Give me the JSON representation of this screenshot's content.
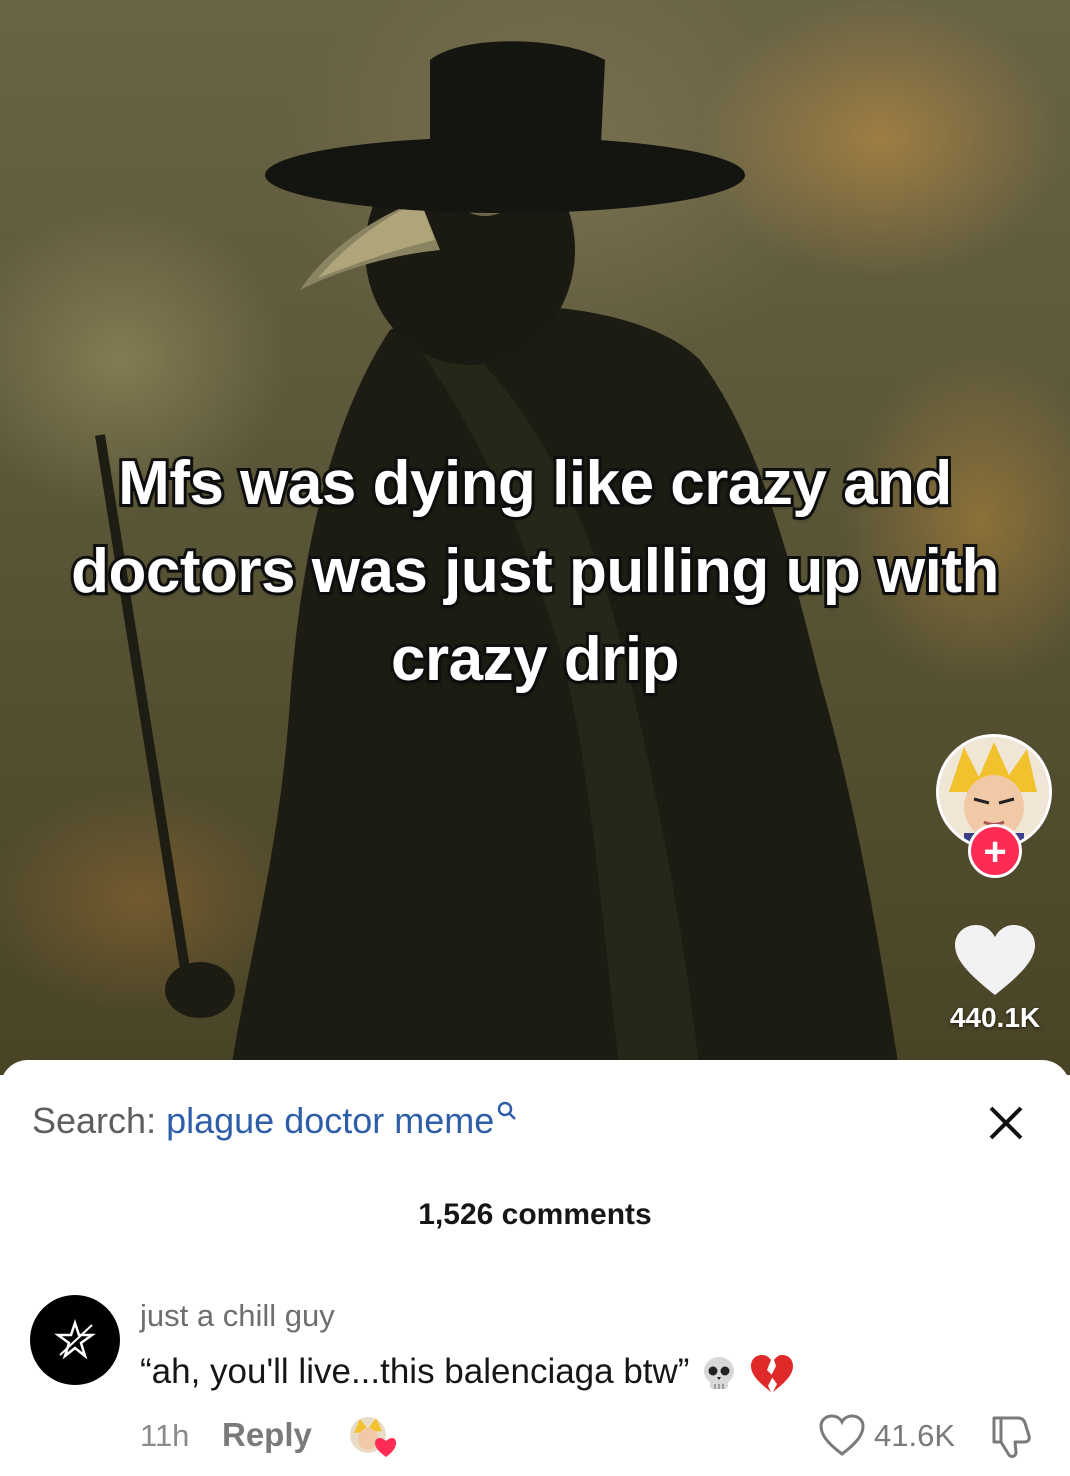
{
  "video": {
    "caption": "Mfs was dying like crazy and doctors was just pulling up with crazy drip",
    "like_count": "440.1K",
    "follow_symbol": "+"
  },
  "comments_panel": {
    "search_prefix": "Search:",
    "search_term": "plague doctor meme",
    "comment_count": "1,526 comments",
    "comments": [
      {
        "username": "just a chill guy",
        "text": "“ah, you'll live...this balenciaga btw”",
        "time": "11h",
        "reply_label": "Reply",
        "like_count": "41.6K"
      }
    ]
  },
  "icons": {
    "search": "search-icon",
    "close": "close-icon",
    "heart": "heart-icon",
    "dislike": "dislike-icon",
    "skull": "skull-emoji",
    "broken_heart": "broken-heart-emoji"
  },
  "colors": {
    "accent": "#fe2c55",
    "link": "#2f5ea8"
  }
}
